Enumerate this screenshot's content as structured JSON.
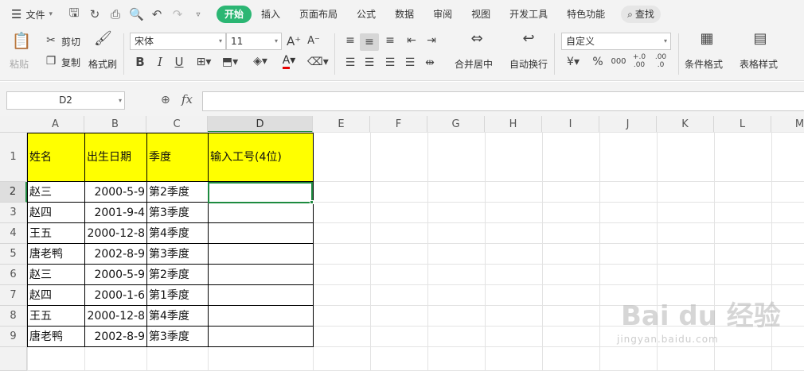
{
  "menubar": {
    "file_label": "文件",
    "tabs": [
      "开始",
      "插入",
      "页面布局",
      "公式",
      "数据",
      "审阅",
      "视图",
      "开发工具",
      "特色功能"
    ],
    "search_label": "查找"
  },
  "ribbon": {
    "paste_label": "粘贴",
    "cut_label": "剪切",
    "copy_label": "复制",
    "format_painter_label": "格式刷",
    "font_name": "宋体",
    "font_size": "11",
    "merge_label": "合并居中",
    "wrap_label": "自动换行",
    "number_format": "自定义",
    "currency_symbol": "¥",
    "percent_symbol": "%",
    "thousands_symbol": "000",
    "inc_decimal": "+.0 .00",
    "dec_decimal": ".00 →.0",
    "cond_format_label": "条件格式",
    "table_style_label": "表格样式"
  },
  "formula_bar": {
    "name_box": "D2",
    "fx": "fx",
    "formula": ""
  },
  "sheet": {
    "columns": [
      "A",
      "B",
      "C",
      "D",
      "E",
      "F",
      "G",
      "H",
      "I",
      "J",
      "K",
      "L",
      "M"
    ],
    "rows": [
      "1",
      "2",
      "3",
      "4",
      "5",
      "6",
      "7",
      "8",
      "9"
    ],
    "headers": [
      "姓名",
      "出生日期",
      "季度",
      "输入工号(4位)"
    ],
    "data": [
      [
        "赵三",
        "2000-5-9",
        "第2季度",
        ""
      ],
      [
        "赵四",
        "2001-9-4",
        "第3季度",
        ""
      ],
      [
        "王五",
        "2000-12-8",
        "第4季度",
        ""
      ],
      [
        "唐老鸭",
        "2002-8-9",
        "第3季度",
        ""
      ],
      [
        "赵三",
        "2000-5-9",
        "第2季度",
        ""
      ],
      [
        "赵四",
        "2000-1-6",
        "第1季度",
        ""
      ],
      [
        "王五",
        "2000-12-8",
        "第4季度",
        ""
      ],
      [
        "唐老鸭",
        "2002-8-9",
        "第3季度",
        ""
      ]
    ],
    "active_cell": "D2"
  },
  "watermark": {
    "main": "Bai du 经验",
    "sub": "jingyan.baidu.com"
  },
  "colors": {
    "accent": "#2bb673",
    "header_fill": "#ffff00",
    "selection": "#1d8a3f"
  }
}
